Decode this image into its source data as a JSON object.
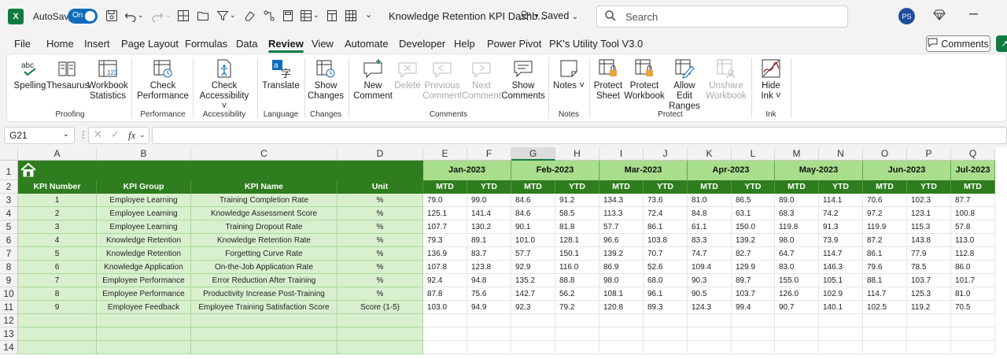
{
  "titlebar": {
    "app_icon": "X",
    "autosave_label": "AutoSave",
    "autosave_state": "On",
    "doc_title": "Knowledge Retention KPI Dashb...",
    "saved": "• Saved",
    "search_placeholder": "Search",
    "avatar": "PS"
  },
  "menu": {
    "tabs": [
      "File",
      "Home",
      "Insert",
      "Page Layout",
      "Formulas",
      "Data",
      "Review",
      "View",
      "Automate",
      "Developer",
      "Help",
      "Power Pivot",
      "PK's Utility Tool V3.0"
    ],
    "active": "Review",
    "comments_button": "Comments"
  },
  "ribbon": {
    "buttons": [
      {
        "label": "Spelling",
        "icon": "spelling-icon"
      },
      {
        "label": "Thesaurus",
        "icon": "thesaurus-icon"
      },
      {
        "label": "Workbook Statistics",
        "icon": "workbook-statistics-icon"
      },
      {
        "label": "Check Performance",
        "icon": "check-performance-icon"
      },
      {
        "label": "Check Accessibility ˅",
        "icon": "accessibility-icon"
      },
      {
        "label": "Translate",
        "icon": "translate-icon"
      },
      {
        "label": "Show Changes",
        "icon": "show-changes-icon"
      },
      {
        "label": "New Comment",
        "icon": "new-comment-icon"
      },
      {
        "label": "Delete",
        "icon": "delete-comment-icon",
        "disabled": true
      },
      {
        "label": "Previous Comment",
        "icon": "previous-comment-icon",
        "disabled": true
      },
      {
        "label": "Next Comment",
        "icon": "next-comment-icon",
        "disabled": true
      },
      {
        "label": "Show Comments",
        "icon": "show-comments-icon"
      },
      {
        "label": "Notes ˅",
        "icon": "notes-icon"
      },
      {
        "label": "Protect Sheet",
        "icon": "protect-sheet-icon"
      },
      {
        "label": "Protect Workbook",
        "icon": "protect-workbook-icon"
      },
      {
        "label": "Allow Edit Ranges",
        "icon": "allow-edit-ranges-icon"
      },
      {
        "label": "Unshare Workbook",
        "icon": "unshare-workbook-icon",
        "disabled": true
      },
      {
        "label": "Hide Ink ˅",
        "icon": "hide-ink-icon"
      }
    ],
    "groups": [
      "Proofing",
      "Performance",
      "Accessibility",
      "Language",
      "Changes",
      "Comments",
      "Notes",
      "Protect",
      "Ink"
    ]
  },
  "formula_bar": {
    "name_box": "G21",
    "fx": "fx",
    "formula": ""
  },
  "sheet": {
    "columns": [
      "A",
      "B",
      "C",
      "D",
      "E",
      "F",
      "G",
      "H",
      "I",
      "J",
      "K",
      "L",
      "M",
      "N",
      "O",
      "P",
      "Q"
    ],
    "selected_column": "G",
    "row_numbers": [
      "1",
      "2",
      "3",
      "4",
      "5",
      "6",
      "7",
      "8",
      "9",
      "10",
      "11",
      "12",
      "13",
      "14"
    ],
    "headers": [
      "KPI Number",
      "KPI Group",
      "KPI Name",
      "Unit"
    ],
    "months": [
      "Jan-2023",
      "Feb-2023",
      "Mar-2023",
      "Apr-2023",
      "May-2023",
      "Jun-2023",
      "Jul-2023"
    ],
    "sub_headers": [
      "MTD",
      "YTD"
    ],
    "rows": [
      {
        "num": "1",
        "group": "Employee Learning",
        "name": "Training Completion Rate",
        "unit": "%",
        "values": [
          "79.0",
          "99.0",
          "84.6",
          "91.2",
          "134.3",
          "73.6",
          "81.0",
          "86.5",
          "89.0",
          "114.1",
          "70.6",
          "102.3",
          "87.7"
        ]
      },
      {
        "num": "2",
        "group": "Employee Learning",
        "name": "Knowledge Assessment Score",
        "unit": "%",
        "values": [
          "125.1",
          "141.4",
          "84.6",
          "58.5",
          "113.3",
          "72.4",
          "84.8",
          "63.1",
          "68.3",
          "74.2",
          "97.2",
          "123.1",
          "100.8"
        ]
      },
      {
        "num": "3",
        "group": "Employee Learning",
        "name": "Training Dropout Rate",
        "unit": "%",
        "values": [
          "107.7",
          "130.2",
          "90.1",
          "81.8",
          "57.7",
          "86.1",
          "61.1",
          "150.0",
          "119.8",
          "91.3",
          "119.9",
          "115.3",
          "57.8"
        ]
      },
      {
        "num": "4",
        "group": "Knowledge Retention",
        "name": "Knowledge Retention Rate",
        "unit": "%",
        "values": [
          "79.3",
          "89.1",
          "101.0",
          "128.1",
          "96.6",
          "103.8",
          "83.3",
          "139.2",
          "98.0",
          "73.9",
          "87.2",
          "143.8",
          "113.0"
        ]
      },
      {
        "num": "5",
        "group": "Knowledge Retention",
        "name": "Forgetting Curve Rate",
        "unit": "%",
        "values": [
          "136.9",
          "83.7",
          "57.7",
          "150.1",
          "139.2",
          "70.7",
          "74.7",
          "82.7",
          "64.7",
          "114.7",
          "86.1",
          "77.9",
          "112.8"
        ]
      },
      {
        "num": "6",
        "group": "Knowledge Application",
        "name": "On-the-Job Application Rate",
        "unit": "%",
        "values": [
          "107.8",
          "123.8",
          "92.9",
          "116.0",
          "86.9",
          "52.6",
          "109.4",
          "129.9",
          "83.0",
          "146.3",
          "79.6",
          "78.5",
          "86.0"
        ]
      },
      {
        "num": "7",
        "group": "Employee Performance",
        "name": "Error Reduction After Training",
        "unit": "%",
        "values": [
          "92.4",
          "94.8",
          "135.2",
          "88.8",
          "98.0",
          "68.0",
          "90.3",
          "89.7",
          "155.0",
          "105.1",
          "88.1",
          "103.7",
          "101.7"
        ]
      },
      {
        "num": "8",
        "group": "Employee Performance",
        "name": "Productivity Increase Post-Training",
        "unit": "%",
        "values": [
          "87.8",
          "75.6",
          "142.7",
          "56.2",
          "108.1",
          "96.1",
          "90.5",
          "103.7",
          "126.0",
          "102.9",
          "114.7",
          "125.3",
          "81.0"
        ]
      },
      {
        "num": "9",
        "group": "Employee Feedback",
        "name": "Employee Training Satisfaction Score",
        "unit": "Score (1-5)",
        "values": [
          "103.0",
          "94.9",
          "92.3",
          "79.2",
          "120.8",
          "89.3",
          "124.3",
          "99.4",
          "90.7",
          "140.1",
          "102.5",
          "119.2",
          "70.5"
        ]
      }
    ]
  }
}
